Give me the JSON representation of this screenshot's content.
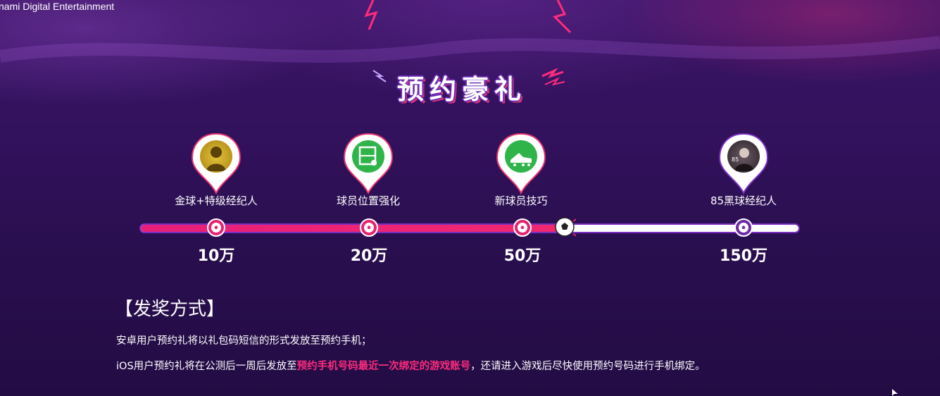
{
  "copyright": "nami Digital Entertainment",
  "title": "预约豪礼",
  "rewards": [
    {
      "label": "金球+特级经纪人",
      "amount": "10万",
      "icon": "gold-agent-icon",
      "reached": true
    },
    {
      "label": "球员位置强化",
      "amount": "20万",
      "icon": "position-boost-icon",
      "reached": true
    },
    {
      "label": "新球员技巧",
      "amount": "50万",
      "icon": "football-boot-icon",
      "reached": true
    },
    {
      "label": "85黑球经纪人",
      "amount": "150万",
      "icon": "black-agent-icon",
      "reached": false
    }
  ],
  "progress_fraction": 0.64,
  "section": {
    "title": "【发奖方式】",
    "line1": "安卓用户预约礼将以礼包码短信的形式发放至预约手机；",
    "line2_pre": "iOS用户预约礼将在公测后一周后发放至",
    "line2_highlight": "预约手机号码最近一次绑定的游戏账号",
    "line2_post": "，还请进入游戏后尽快使用预约号码进行手机绑定。"
  },
  "colors": {
    "accent": "#e81f7a",
    "purple": "#6d2aa8",
    "highlight": "#ff2b7d"
  }
}
